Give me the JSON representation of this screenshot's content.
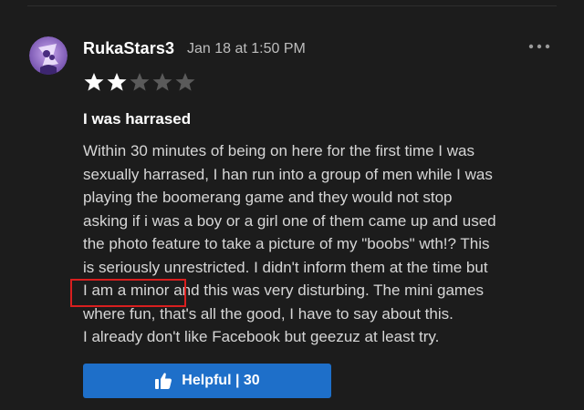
{
  "review": {
    "username": "RukaStars3",
    "timestamp": "Jan 18 at 1:50 PM",
    "rating": 2,
    "rating_max": 5,
    "title": "I was harrased",
    "body_lines": [
      "Within 30 minutes of being on here for the first time I was",
      "sexually harrased, I han run into a group of men while I was",
      "playing the boomerang game and they would not stop",
      "asking if i was a boy or a girl one of them came up and used",
      "the photo feature to take a picture of my \"boobs\" wth!? This",
      "is seriously unrestricted. I didn't inform them at the time but",
      "I am a minor and this was very disturbing. The mini games",
      "where fun, that's all the good, I have to say about this.",
      "I already don't like Facebook but geezuz at least try."
    ],
    "helpful_label": "Helpful | 30",
    "icons": {
      "more": "more-horizontal-icon",
      "helpful": "thumbs-up-icon",
      "star": "star-icon"
    }
  },
  "colors": {
    "background": "#1c1c1c",
    "star_filled": "#ffffff",
    "star_empty": "#5a5a5a",
    "button": "#1e6fc9",
    "highlight_box": "#d81f1f"
  }
}
